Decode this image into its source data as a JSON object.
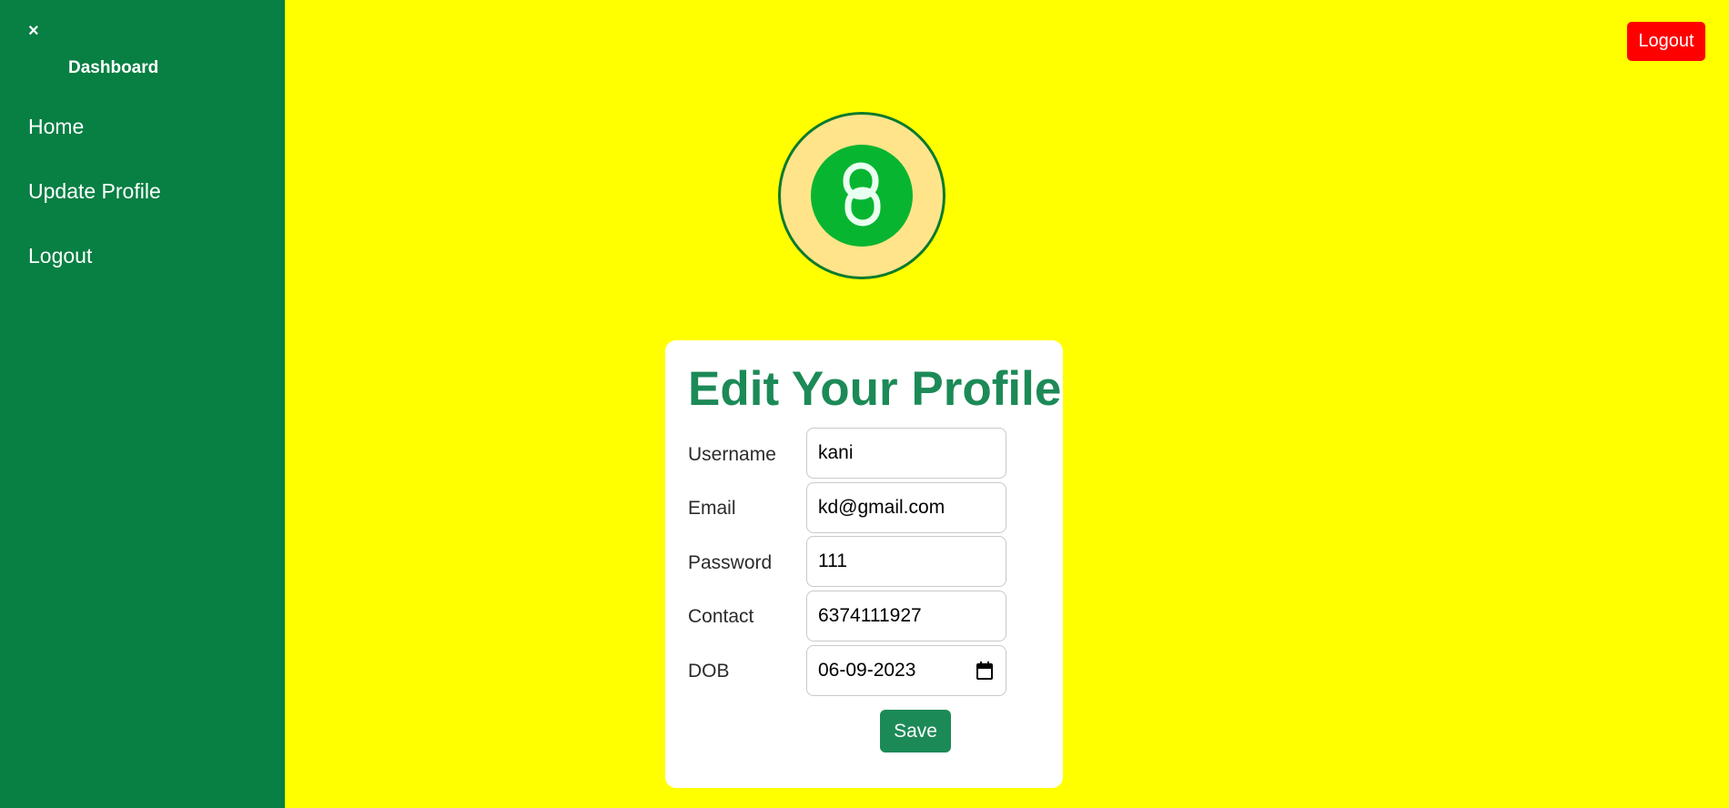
{
  "sidebar": {
    "close_glyph": "×",
    "title": "Dashboard",
    "items": [
      {
        "label": "Home"
      },
      {
        "label": "Update Profile"
      },
      {
        "label": "Logout"
      }
    ]
  },
  "header": {
    "logout_label": "Logout"
  },
  "logo": {
    "icon": "chain-link-icon"
  },
  "form": {
    "title": "Edit Your Profile",
    "fields": [
      {
        "label": "Username",
        "value": "kani"
      },
      {
        "label": "Email",
        "value": "kd@gmail.com"
      },
      {
        "label": "Password",
        "value": "111"
      },
      {
        "label": "Contact",
        "value": "6374111927"
      },
      {
        "label": "DOB",
        "value": "06-09-2023"
      }
    ],
    "save_label": "Save"
  },
  "colors": {
    "page_background": "#ffff00",
    "sidebar": "#087f43",
    "logout_button": "#ff0000",
    "accent": "#1c8a57",
    "logo_ring": "#ffe48a",
    "logo_center": "#08b531"
  }
}
